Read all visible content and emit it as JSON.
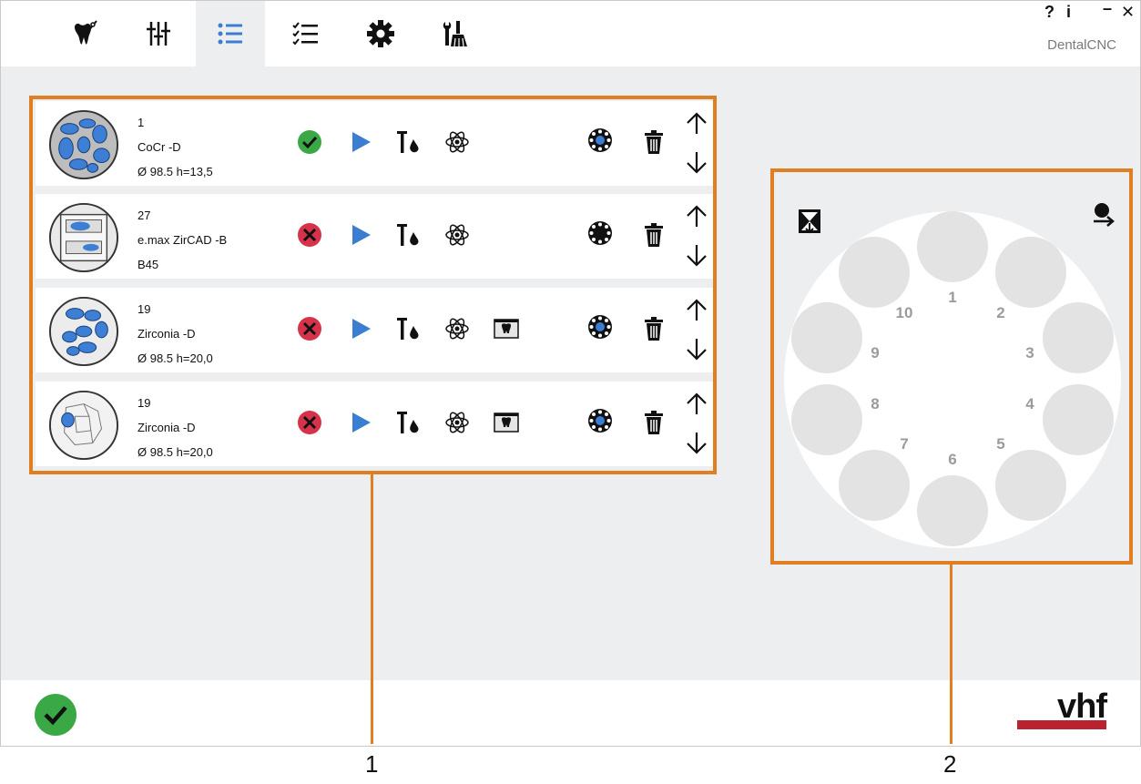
{
  "app": {
    "brand": "DentalCNC",
    "help": "?",
    "info": "i",
    "minimize": "–",
    "close": "✕"
  },
  "tabs": [
    {
      "icon": "tooth-tool-icon",
      "active": false
    },
    {
      "icon": "sliders-icon",
      "active": false
    },
    {
      "icon": "job-list-icon",
      "active": true
    },
    {
      "icon": "checklist-icon",
      "active": false
    },
    {
      "icon": "gear-icon",
      "active": false
    },
    {
      "icon": "maintenance-tools-icon",
      "active": false
    }
  ],
  "jobs": [
    {
      "number": "1",
      "material": "CoCr -D",
      "dims": "Ø 98.5  h=13,5",
      "status": "ok",
      "extra_icon": false
    },
    {
      "number": "27",
      "material": "e.max ZirCAD -B",
      "dims": "B45",
      "status": "error",
      "extra_icon": false
    },
    {
      "number": "19",
      "material": "Zirconia -D",
      "dims": "Ø 98.5  h=20,0",
      "status": "error",
      "extra_icon": true
    },
    {
      "number": "19",
      "material": "Zirconia -D",
      "dims": "Ø 98.5  h=20,0",
      "status": "error",
      "extra_icon": true
    }
  ],
  "magazine": {
    "positions": [
      "1",
      "2",
      "3",
      "4",
      "5",
      "6",
      "7",
      "8",
      "9",
      "10"
    ]
  },
  "callouts": {
    "one": "1",
    "two": "2"
  },
  "footer": {
    "status": "ok",
    "logo": "vhf"
  },
  "colors": {
    "accent": "#e07e22",
    "ok": "#3aa845",
    "error": "#d6334a",
    "play": "#3a7dd1",
    "active_tab_icon": "#3a7dd1",
    "logo_bar": "#b8232f"
  }
}
